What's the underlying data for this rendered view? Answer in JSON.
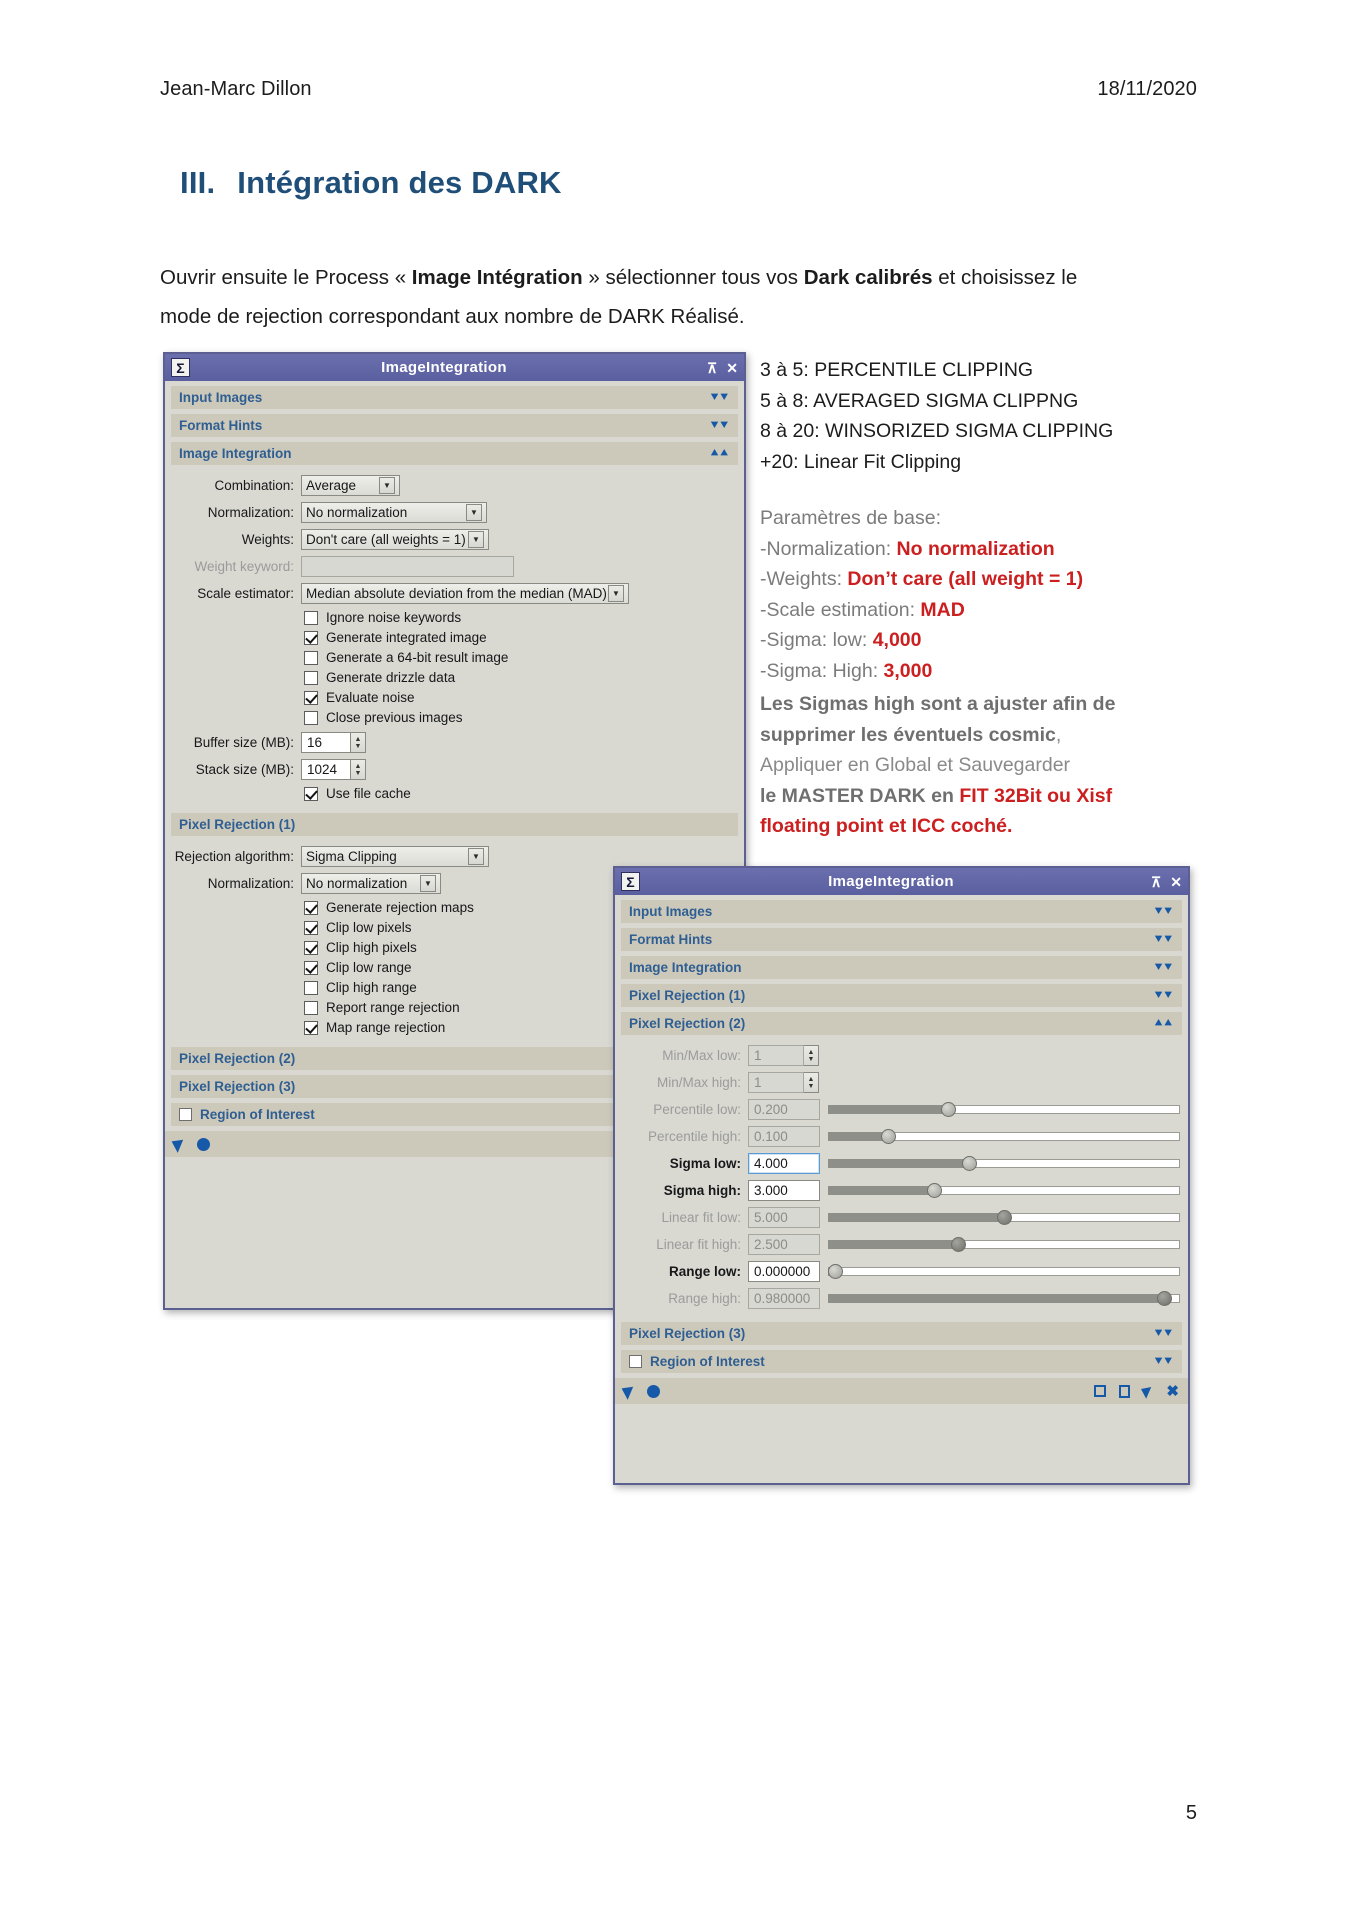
{
  "header": {
    "author": "Jean-Marc Dillon",
    "date": "18/11/2020"
  },
  "heading": {
    "number": "III.",
    "text": "Intégration des DARK"
  },
  "intro": {
    "line1_a": "Ouvrir ensuite le Process « ",
    "line1_b": "Image Intégration",
    "line1_c": " » sélectionner tous vos ",
    "line1_d": "Dark calibrés",
    "line1_e": " et choisissez le",
    "line2": "mode de rejection correspondant aux nombre de DARK Réalisé."
  },
  "notes": {
    "rejection_modes": [
      "3 à 5: PERCENTILE CLIPPING",
      "5 à 8: AVERAGED SIGMA CLIPPNG",
      "8 à 20: WINSORIZED SIGMA CLIPPING",
      "+20: Linear Fit Clipping"
    ],
    "params_title": "Paramètres de base:",
    "params": [
      {
        "label": "-Normalization: ",
        "value": "No normalization"
      },
      {
        "label": "-Weights: ",
        "value": "Don’t care (all weight = 1)"
      },
      {
        "label": "-Scale estimation: ",
        "value": "MAD"
      },
      {
        "label": "-Sigma: low: ",
        "value": "4,000"
      },
      {
        "label": "-Sigma: High: ",
        "value": "3,000"
      }
    ],
    "advice_1": "Les Sigmas high sont a ajuster afin de",
    "advice_2": "supprimer les éventuels cosmic",
    "advice_2_tail": ",",
    "advice_3": "Appliquer en Global et Sauvegarder",
    "advice_4_a": "le MASTER DARK en ",
    "advice_4_b": "FIT 32Bit ou Xisf",
    "advice_5": "floating point et ICC coché."
  },
  "dialog1": {
    "title": "ImageIntegration",
    "icon": "Σ",
    "sigma_icon_name": "sigma-icon",
    "collapse_label": "⊼",
    "close_label": "✕",
    "sections": {
      "input_images": "Input Images",
      "format_hints": "Format Hints",
      "image_integration": "Image Integration",
      "pixel_rejection_1": "Pixel Rejection (1)",
      "pixel_rejection_2": "Pixel Rejection (2)",
      "pixel_rejection_3": "Pixel Rejection (3)",
      "region_of_interest": "Region of Interest"
    },
    "fields": {
      "combination_label": "Combination:",
      "combination_value": "Average",
      "normalization_label": "Normalization:",
      "normalization_value": "No normalization",
      "weights_label": "Weights:",
      "weights_value": "Don't care (all weights = 1)",
      "weight_keyword_label": "Weight keyword:",
      "weight_keyword_value": "",
      "scale_estimator_label": "Scale estimator:",
      "scale_estimator_value": "Median absolute deviation from the median (MAD)",
      "buffer_size_label": "Buffer size (MB):",
      "buffer_size_value": "16",
      "stack_size_label": "Stack size (MB):",
      "stack_size_value": "1024",
      "rejection_algorithm_label": "Rejection algorithm:",
      "rejection_algorithm_value": "Sigma Clipping",
      "rej_normalization_label": "Normalization:",
      "rej_normalization_value": "No normalization"
    },
    "checkboxes_integration": [
      {
        "label": "Ignore noise keywords",
        "checked": false
      },
      {
        "label": "Generate integrated image",
        "checked": true
      },
      {
        "label": "Generate a 64-bit result image",
        "checked": false
      },
      {
        "label": "Generate drizzle data",
        "checked": false
      },
      {
        "label": "Evaluate noise",
        "checked": true
      },
      {
        "label": "Close previous images",
        "checked": false
      }
    ],
    "checkbox_file_cache": {
      "label": "Use file cache",
      "checked": true
    },
    "checkboxes_rejection": [
      {
        "label": "Generate rejection maps",
        "checked": true
      },
      {
        "label": "Clip low pixels",
        "checked": true
      },
      {
        "label": "Clip high pixels",
        "checked": true
      },
      {
        "label": "Clip low range",
        "checked": true
      },
      {
        "label": "Clip high range",
        "checked": false
      },
      {
        "label": "Report range rejection",
        "checked": false
      },
      {
        "label": "Map range rejection",
        "checked": true
      }
    ]
  },
  "dialog2": {
    "title": "ImageIntegration",
    "icon": "Σ",
    "collapse_label": "⊼",
    "close_label": "✕",
    "sections": {
      "input_images": "Input Images",
      "format_hints": "Format Hints",
      "image_integration": "Image Integration",
      "pixel_rejection_1": "Pixel Rejection (1)",
      "pixel_rejection_2": "Pixel Rejection (2)",
      "pixel_rejection_3": "Pixel Rejection (3)",
      "region_of_interest": "Region of Interest"
    },
    "params": [
      {
        "label": "Min/Max low:",
        "value": "1",
        "type": "spin",
        "enabled": false,
        "slider": null
      },
      {
        "label": "Min/Max high:",
        "value": "1",
        "type": "spin",
        "enabled": false,
        "slider": null
      },
      {
        "label": "Percentile low:",
        "value": "0.200",
        "type": "slider",
        "enabled": false,
        "slider": 34
      },
      {
        "label": "Percentile high:",
        "value": "0.100",
        "type": "slider",
        "enabled": false,
        "slider": 17
      },
      {
        "label": "Sigma low:",
        "value": "4.000",
        "type": "slider",
        "enabled": true,
        "slider": 40
      },
      {
        "label": "Sigma high:",
        "value": "3.000",
        "type": "slider",
        "enabled": true,
        "slider": 30
      },
      {
        "label": "Linear fit low:",
        "value": "5.000",
        "type": "slider",
        "enabled": false,
        "slider": 50
      },
      {
        "label": "Linear fit high:",
        "value": "2.500",
        "type": "slider",
        "enabled": false,
        "slider": 37
      },
      {
        "label": "Range low:",
        "value": "0.000000",
        "type": "slider",
        "enabled": true,
        "slider": 1
      },
      {
        "label": "Range high:",
        "value": "0.980000",
        "type": "slider",
        "enabled": false,
        "slider": 96
      }
    ]
  },
  "footer": {
    "page_number": "5"
  }
}
